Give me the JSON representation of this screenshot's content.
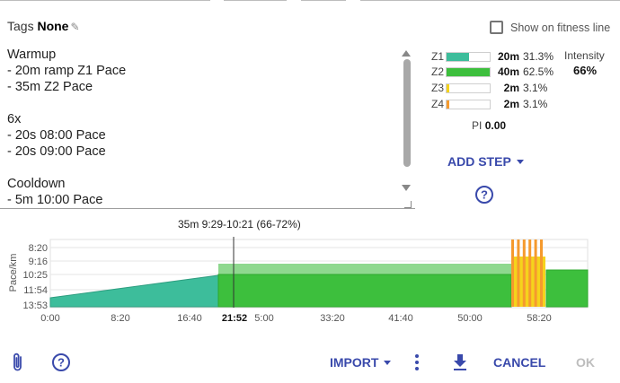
{
  "tags": {
    "label": "Tags",
    "value": "None"
  },
  "fitness_line": {
    "label": "Show on fitness line",
    "checked": false
  },
  "workout_text": "Warmup\n- 20m ramp Z1 Pace\n- 35m Z2 Pace\n\n6x\n- 20s 08:00 Pace\n- 20s 09:00 Pace\n\nCooldown\n- 5m 10:00 Pace",
  "zones": [
    {
      "name": "Z1",
      "time": "20m",
      "pct": "31.3%",
      "fill": 0.52,
      "color": "#3dbd9b"
    },
    {
      "name": "Z2",
      "time": "40m",
      "pct": "62.5%",
      "fill": 1.0,
      "color": "#3dbf3d"
    },
    {
      "name": "Z3",
      "time": "2m",
      "pct": "3.1%",
      "fill": 0.06,
      "color": "#f5d31c"
    },
    {
      "name": "Z4",
      "time": "2m",
      "pct": "3.1%",
      "fill": 0.06,
      "color": "#f59a2e"
    }
  ],
  "intensity": {
    "label": "Intensity",
    "value": "66%"
  },
  "pi": {
    "label": "PI",
    "value": "0.00"
  },
  "add_step_label": "ADD STEP",
  "chart_data": {
    "type": "area",
    "title": "35m 9:29-10:21 (66-72%)",
    "ylabel": "Pace/km",
    "yticks": [
      "8:20",
      "9:16",
      "10:25",
      "11:54",
      "13:53"
    ],
    "xticks": [
      "0:00",
      "8:20",
      "16:40",
      "21:52",
      "5:00",
      "33:20",
      "41:40",
      "50:00",
      "58:20"
    ],
    "highlight_x_label": "21:52",
    "colors": {
      "z1": "#3dbd9b",
      "z2": "#3dbf3d",
      "z2_light": "#8ed88e",
      "z3": "#f5d31c",
      "z4": "#f59a2e"
    },
    "segments": [
      {
        "name": "warmup-ramp",
        "start_min": 0,
        "end_min": 20,
        "zone": "Z1"
      },
      {
        "name": "steady-z2",
        "start_min": 20,
        "end_min": 55,
        "zone": "Z2"
      },
      {
        "name": "intervals-6x",
        "start_min": 55,
        "end_min": 59,
        "zone": "Z3/Z4"
      },
      {
        "name": "cooldown",
        "start_min": 59,
        "end_min": 64,
        "zone": "Z2"
      }
    ]
  },
  "footer": {
    "import_label": "IMPORT",
    "cancel_label": "CANCEL",
    "ok_label": "OK"
  }
}
